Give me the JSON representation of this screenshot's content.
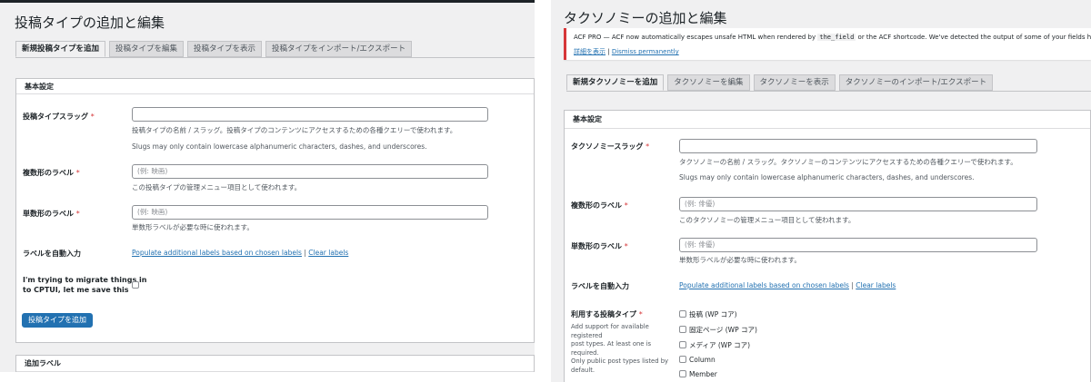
{
  "left": {
    "title": "投稿タイプの追加と編集",
    "tabs": [
      "新規投稿タイプを追加",
      "投稿タイプを編集",
      "投稿タイプを表示",
      "投稿タイプをインポート/エクスポート"
    ],
    "section_title": "基本設定",
    "slug": {
      "label": "投稿タイプスラッグ",
      "required_mark": "*",
      "value": "",
      "desc1": "投稿タイプの名前 / スラッグ。投稿タイプのコンテンツにアクセスするための各種クエリーで使われます。",
      "desc2": "Slugs may only contain lowercase alphanumeric characters, dashes, and underscores."
    },
    "plural": {
      "label": "複数形のラベル",
      "required_mark": "*",
      "placeholder": "(例: 映画)",
      "desc": "この投稿タイプの管理メニュー項目として使われます。"
    },
    "singular": {
      "label": "単数形のラベル",
      "required_mark": "*",
      "placeholder": "(例: 映画)",
      "desc": "単数形ラベルが必要な時に使われます。"
    },
    "auto_label": {
      "label": "ラベルを自動入力",
      "populate_link": "Populate additional labels based on chosen labels",
      "separator": "|",
      "clear_link": "Clear labels"
    },
    "migrate": {
      "label_line1": "I'm trying to migrate things in",
      "label_line2": "to CPTUI, let me save this"
    },
    "submit_label": "投稿タイプを追加",
    "additional_section": "追加ラベル"
  },
  "right": {
    "title": "タクソノミーの追加と編集",
    "notice": {
      "text_before": "ACF PRO — ACF now automatically escapes unsafe HTML when rendered by",
      "code": "the_field",
      "text_after": "or the ACF shortcode. We've detected the output of some of your fields has been modified b",
      "details_link": "詳細を表示",
      "separator": "|",
      "dismiss_link": "Dismiss permanently"
    },
    "tabs": [
      "新規タクソノミーを追加",
      "タクソノミーを編集",
      "タクソノミーを表示",
      "タクソノミーのインポート/エクスポート"
    ],
    "section_title": "基本設定",
    "slug": {
      "label": "タクソノミースラッグ",
      "required_mark": "*",
      "value": "",
      "desc1": "タクソノミーの名前 / スラッグ。タクソノミーのコンテンツにアクセスするための各種クエリーで使われます。",
      "desc2": "Slugs may only contain lowercase alphanumeric characters, dashes, and underscores."
    },
    "plural": {
      "label": "複数形のラベル",
      "required_mark": "*",
      "placeholder": "(例: 俳優)",
      "desc": "このタクソノミーの管理メニュー項目として使われます。"
    },
    "singular": {
      "label": "単数形のラベル",
      "required_mark": "*",
      "placeholder": "(例: 俳優)",
      "desc": "単数形ラベルが必要な時に使われます。"
    },
    "auto_label": {
      "label": "ラベルを自動入力",
      "populate_link": "Populate additional labels based on chosen labels",
      "separator": "|",
      "clear_link": "Clear labels"
    },
    "post_types": {
      "label": "利用する投稿タイプ",
      "required_mark": "*",
      "desc_lines": [
        "Add support for available registered",
        "post types. At least one is required.",
        "Only public post types listed by",
        "default."
      ],
      "options": [
        "投稿 (WP コア)",
        "固定ページ (WP コア)",
        "メディア (WP コア)",
        "Column",
        "Member"
      ]
    }
  },
  "colors": {
    "accent": "#2271b1",
    "required": "#d63638",
    "admin_bg": "#f0f0f1",
    "border": "#c3c4c7"
  }
}
